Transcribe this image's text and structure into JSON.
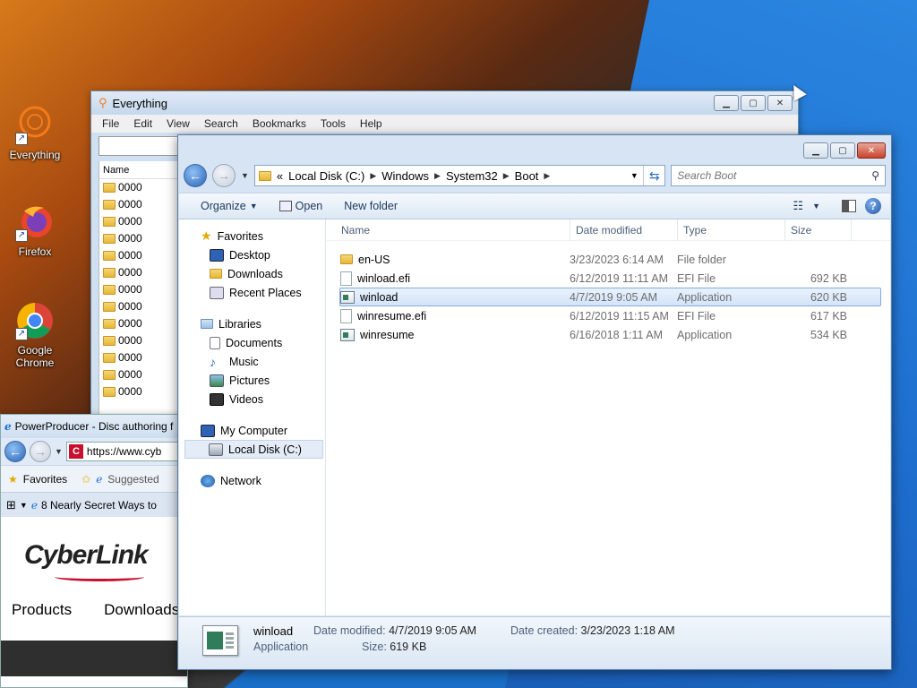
{
  "desktop": {
    "icons": [
      {
        "label": "Everything",
        "icon": "everything-icon"
      },
      {
        "label": "Firefox",
        "icon": "firefox-icon"
      },
      {
        "label": "Google Chrome",
        "icon": "chrome-icon"
      }
    ]
  },
  "everything": {
    "title": "Everything",
    "menu": [
      "File",
      "Edit",
      "View",
      "Search",
      "Bookmarks",
      "Tools",
      "Help"
    ],
    "column_name": "Name",
    "rows": [
      "0000",
      "0000",
      "0000",
      "0000",
      "0000",
      "0000",
      "0000",
      "0000",
      "0000",
      "0000",
      "0000",
      "0000",
      "0000"
    ]
  },
  "ie": {
    "title": "PowerProducer - Disc authoring f",
    "url": "https://www.cyb",
    "favorites_label": "Favorites",
    "suggested_label": "Suggested",
    "tab_label": "8 Nearly Secret Ways to",
    "logo_text": "CyberLink",
    "nav": [
      "Products",
      "Downloads"
    ]
  },
  "explorer": {
    "breadcrumb": [
      "Local Disk (C:)",
      "Windows",
      "System32",
      "Boot"
    ],
    "search_placeholder": "Search Boot",
    "toolbar": {
      "organize": "Organize",
      "open": "Open",
      "new_folder": "New folder"
    },
    "nav": {
      "favorites": "Favorites",
      "favorites_items": [
        "Desktop",
        "Downloads",
        "Recent Places"
      ],
      "libraries": "Libraries",
      "libraries_items": [
        "Documents",
        "Music",
        "Pictures",
        "Videos"
      ],
      "computer": "My Computer",
      "computer_items": [
        "Local Disk (C:)"
      ],
      "network": "Network"
    },
    "columns": {
      "name": "Name",
      "date": "Date modified",
      "type": "Type",
      "size": "Size"
    },
    "files": [
      {
        "name": "en-US",
        "date": "3/23/2023 6:14 AM",
        "type": "File folder",
        "size": "",
        "kind": "folder"
      },
      {
        "name": "winload.efi",
        "date": "6/12/2019 11:11 AM",
        "type": "EFI File",
        "size": "692 KB",
        "kind": "file"
      },
      {
        "name": "winload",
        "date": "4/7/2019 9:05 AM",
        "type": "Application",
        "size": "620 KB",
        "kind": "app"
      },
      {
        "name": "winresume.efi",
        "date": "6/12/2019 11:15 AM",
        "type": "EFI File",
        "size": "617 KB",
        "kind": "file"
      },
      {
        "name": "winresume",
        "date": "6/16/2018 1:11 AM",
        "type": "Application",
        "size": "534 KB",
        "kind": "app"
      }
    ],
    "details": {
      "name": "winload",
      "type": "Application",
      "modified_label": "Date modified:",
      "modified": "4/7/2019 9:05 AM",
      "size_label": "Size:",
      "size": "619 KB",
      "created_label": "Date created:",
      "created": "3/23/2023 1:18 AM"
    }
  }
}
